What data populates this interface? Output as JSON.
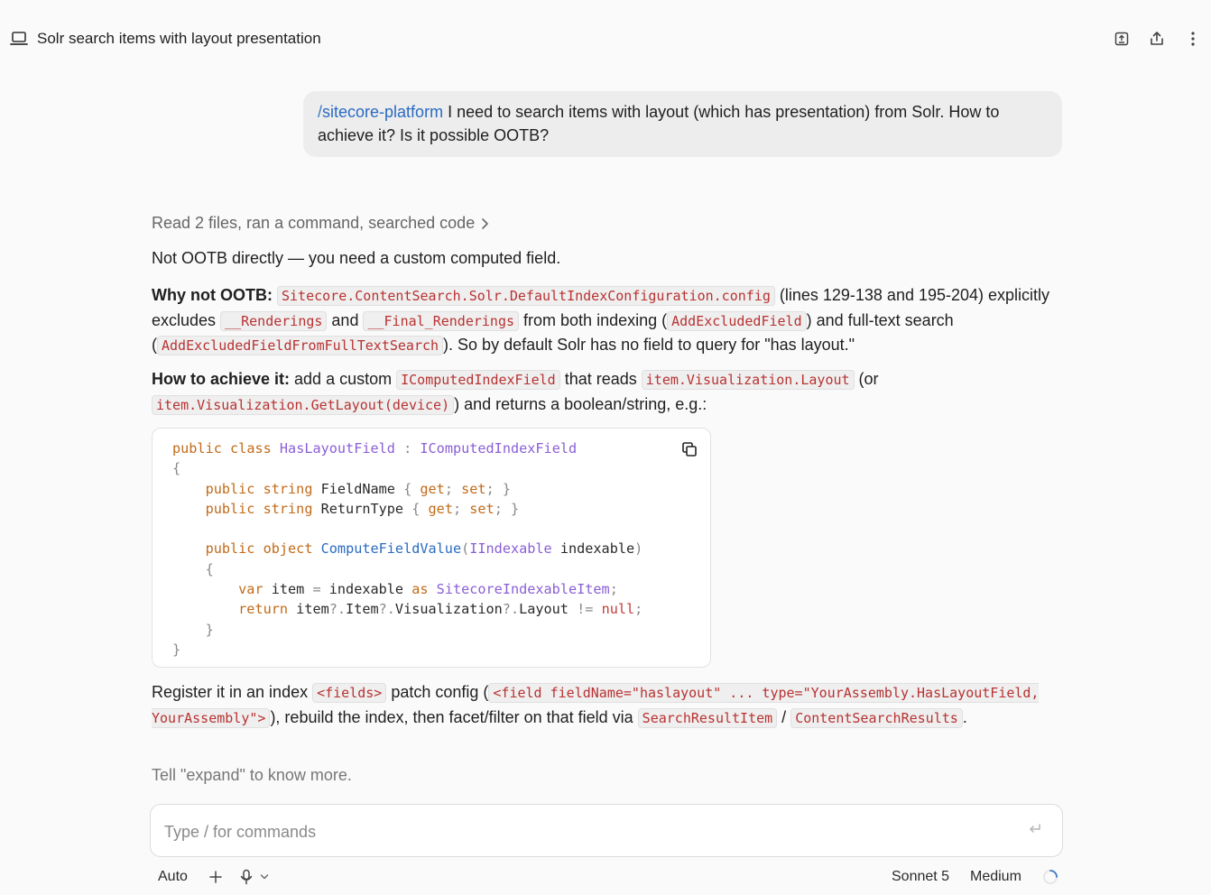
{
  "header": {
    "title": "Solr search items with layout presentation",
    "icons": [
      "laptop-icon",
      "export-icon",
      "share-icon",
      "more-vertical-icon"
    ]
  },
  "user_message": {
    "slash": "/",
    "skill": "sitecore-platform",
    "text": " I need to search items with layout (which has presentation) from Solr. How to achieve it? Is it possible OOTB?"
  },
  "response": {
    "activity": "Read 2 files, ran a command, searched code",
    "p1": "Not OOTB directly — you need a custom computed field.",
    "p2": {
      "label": "Why not OOTB:",
      "code1": "Sitecore.ContentSearch.Solr.DefaultIndexConfiguration.config",
      "t1": " (lines 129-138 and 195-204) explicitly excludes ",
      "code2": "__Renderings",
      "t2": " and ",
      "code3": "__Final_Renderings",
      "t3": " from both indexing (",
      "code4": "AddExcludedField",
      "t4": ") and full-text search (",
      "code5": "AddExcludedFieldFromFullTextSearch",
      "t5": "). So by default Solr has no field to query for \"has layout.\""
    },
    "p3": {
      "label": "How to achieve it:",
      "t1": " add a custom ",
      "code1": "IComputedIndexField",
      "t2": " that reads ",
      "code2": "item.Visualization.Layout",
      "t3": " (or ",
      "code3": "item.Visualization.GetLayout(device)",
      "t4": ") and returns a boolean/string, e.g.:"
    },
    "code_block": {
      "lines": [
        "public class HasLayoutField : IComputedIndexField",
        "{",
        "    public string FieldName { get; set; }",
        "    public string ReturnType { get; set; }",
        "",
        "    public object ComputeFieldValue(IIndexable indexable)",
        "    {",
        "        var item = indexable as SitecoreIndexableItem;",
        "        return item?.Item?.Visualization?.Layout != null;",
        "    }",
        "}"
      ]
    },
    "p4": {
      "t1": "Register it in an index ",
      "code1": "<fields>",
      "t2": " patch config (",
      "code2": "<field fieldName=\"haslayout\" ... type=\"YourAssembly.HasLayoutField, YourAssembly\">",
      "t3": "), rebuild the index, then facet/filter on that field via ",
      "code3": "SearchResultItem",
      "t4": " / ",
      "code4": "ContentSearchResults",
      "t5": "."
    },
    "p5": "Tell \"expand\" to know more."
  },
  "composer": {
    "placeholder": "Type / for commands",
    "mode": "Auto",
    "model": "Sonnet 5",
    "effort": "Medium"
  }
}
